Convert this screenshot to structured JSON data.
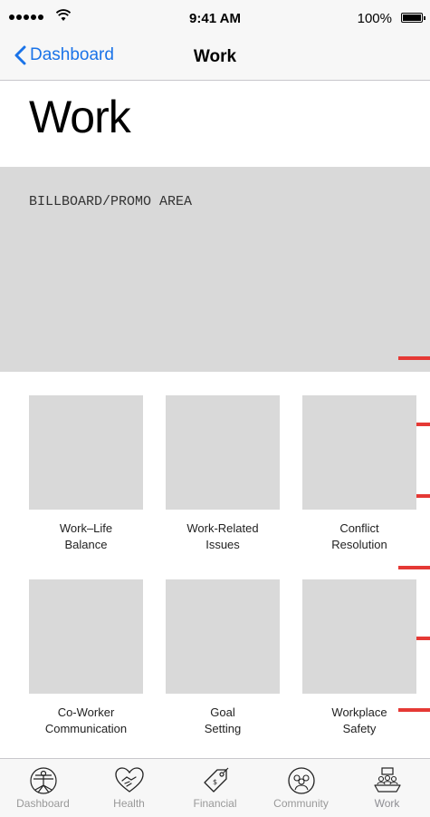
{
  "status_bar": {
    "time": "9:41 AM",
    "battery": "100%"
  },
  "nav": {
    "back_label": "Dashboard",
    "title": "Work"
  },
  "page": {
    "title": "Work"
  },
  "billboard": {
    "label": "BILLBOARD/PROMO AREA"
  },
  "tiles": [
    {
      "label": "Work–Life\nBalance"
    },
    {
      "label": "Work-Related\nIssues"
    },
    {
      "label": "Conflict\nResolution"
    },
    {
      "label": "Co-Worker\nCommunication"
    },
    {
      "label": "Goal\nSetting"
    },
    {
      "label": "Workplace\nSafety"
    }
  ],
  "tabs": [
    {
      "label": "Dashboard",
      "icon": "vitruvian-man-icon"
    },
    {
      "label": "Health",
      "icon": "heart-handshake-icon"
    },
    {
      "label": "Financial",
      "icon": "price-tag-icon"
    },
    {
      "label": "Community",
      "icon": "group-circle-icon"
    },
    {
      "label": "Work",
      "icon": "meeting-table-icon"
    }
  ],
  "colors": {
    "accent": "#1a73e8",
    "placeholder": "#d9d9d9",
    "annotation_red": "#e53935"
  }
}
